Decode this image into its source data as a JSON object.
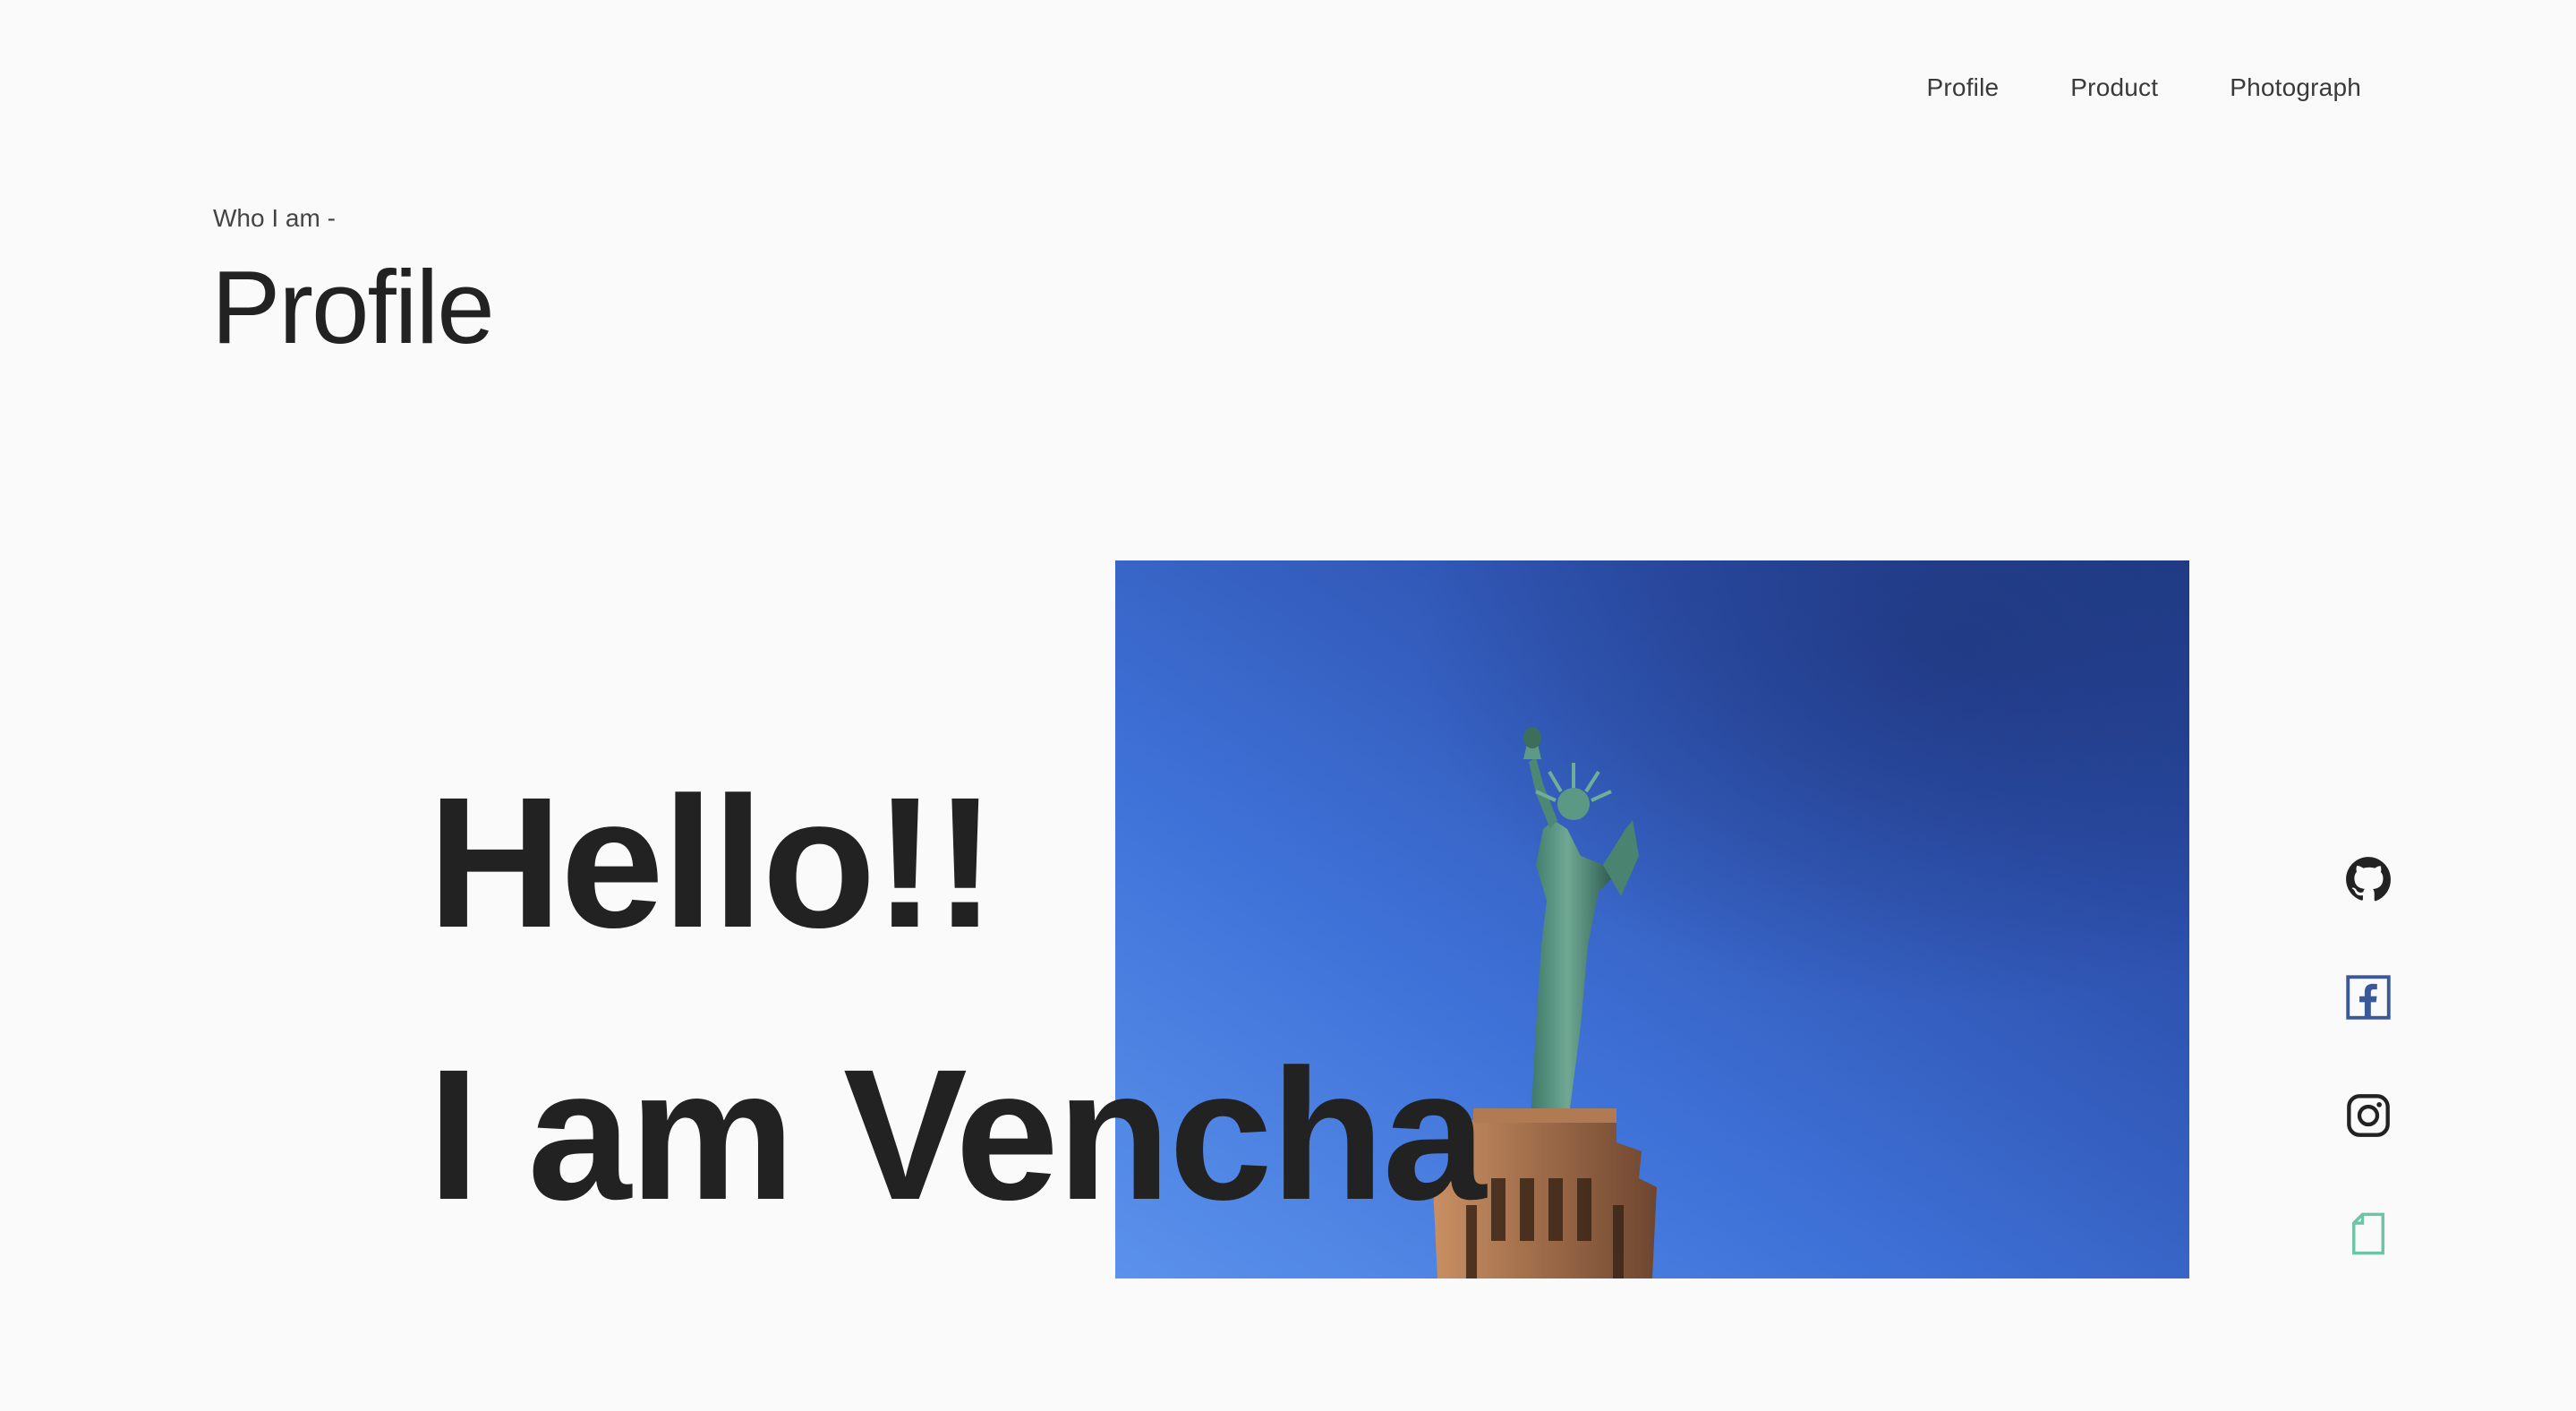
{
  "nav": {
    "items": [
      {
        "label": "Profile"
      },
      {
        "label": "Product"
      },
      {
        "label": "Photograph"
      }
    ]
  },
  "header": {
    "eyebrow": "Who I am -",
    "title": "Profile"
  },
  "hero": {
    "line1": "Hello!!",
    "line2": "I am Vencha",
    "photo_subject": "statue-of-liberty-photo"
  },
  "social": {
    "icons": [
      "github-icon",
      "facebook-icon",
      "instagram-icon",
      "document-icon"
    ],
    "colors": {
      "github": "#222222",
      "facebook": "#3b5998",
      "instagram": "#222222",
      "document": "#6cc5a8"
    }
  },
  "colors": {
    "background": "#fafafa",
    "text": "#222222",
    "sky_light": "#5a8de8",
    "sky_dark": "#23418f"
  }
}
